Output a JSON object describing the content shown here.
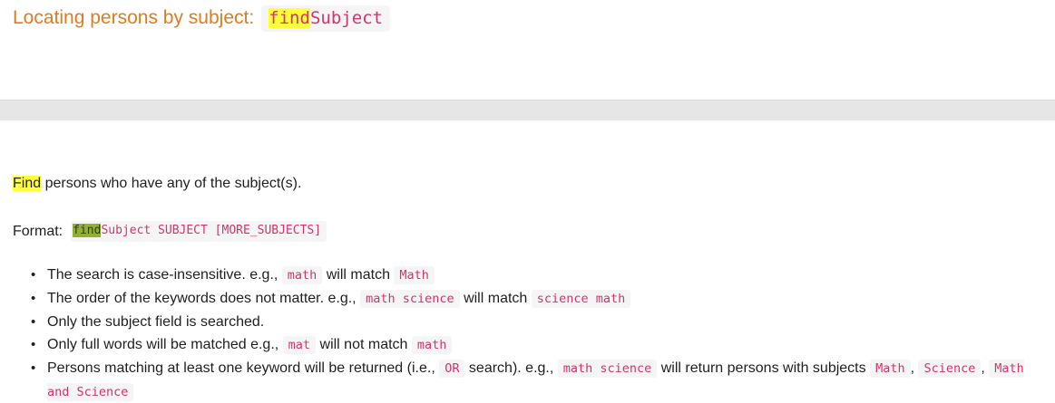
{
  "heading": {
    "text": "Locating persons by subject:",
    "command_highlight": "find",
    "command_rest": "Subject"
  },
  "intro": {
    "highlight": "Find",
    "rest": " persons who have any of the subject(s)."
  },
  "format": {
    "label": "Format:",
    "command_highlight": "find",
    "command_rest": "Subject SUBJECT [MORE_SUBJECTS]"
  },
  "rules": [
    {
      "a": "The search is case-insensitive. e.g., ",
      "code1": "math",
      "b": " will match ",
      "code2": "Math"
    },
    {
      "a": "The order of the keywords does not matter. e.g., ",
      "code1": "math science",
      "b": " will match ",
      "code2": "science math"
    },
    {
      "a": "Only the subject field is searched."
    },
    {
      "a": "Only full words will be matched e.g., ",
      "code1": "mat",
      "b": " will not match ",
      "code2": "math"
    },
    {
      "a": "Persons matching at least one keyword will be returned (i.e., ",
      "code1": "OR",
      "b": " search). e.g., ",
      "code2": "math science",
      "c": " will return persons with subjects ",
      "code3": "Math",
      "d": ", ",
      "code4": "Science",
      "e": ", ",
      "code5": "Math and Science"
    }
  ],
  "colors": {
    "heading": "#e07b1f",
    "code_text": "#d6336c",
    "code_bg": "#f5f5f5",
    "highlight_yellow": "#ffff3a",
    "highlight_green": "#8fb031",
    "separator": "#e6e6e6"
  }
}
